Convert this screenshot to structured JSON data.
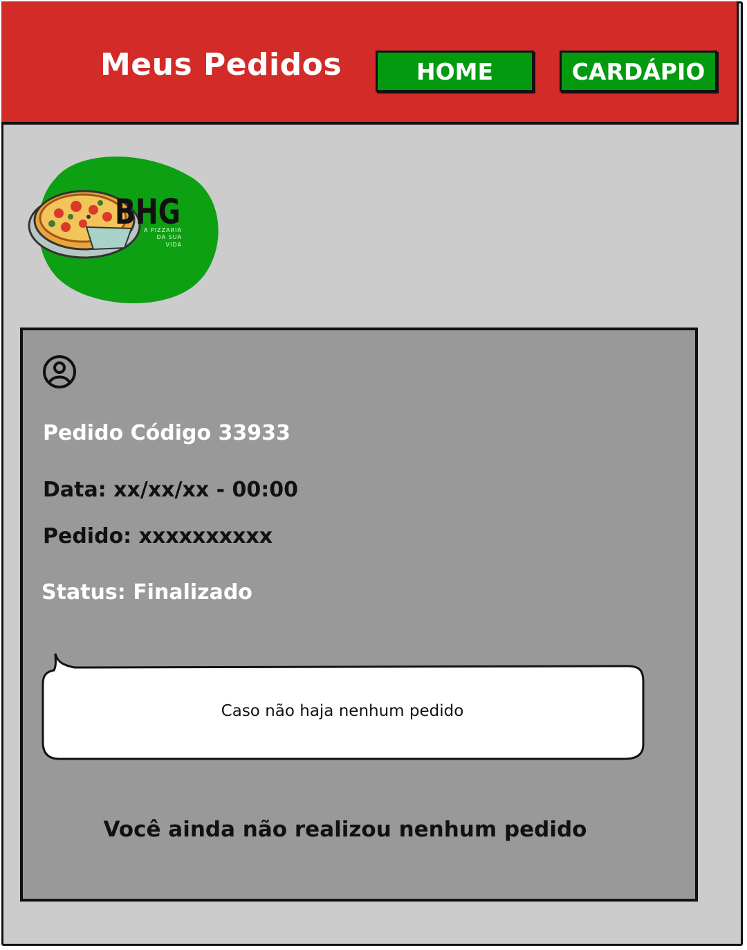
{
  "header": {
    "title": "Meus Pedidos",
    "nav": {
      "home_label": "HOME",
      "menu_label": "CARDÁPIO"
    }
  },
  "logo": {
    "brand": "BHG",
    "tagline_1": "A PIZZARIA",
    "tagline_2": "DA SUA",
    "tagline_3": "VIDA"
  },
  "order": {
    "code_label": "Pedido Código 33933",
    "date_label": "Data: xx/xx/xx  - 00:00",
    "items_label": "Pedido: xxxxxxxxxx",
    "status_label": "Status: Finalizado"
  },
  "note": {
    "bubble_text": "Caso não haja nenhum pedido",
    "empty_message": "Você ainda não realizou nenhum pedido"
  },
  "colors": {
    "header_red": "#d22b28",
    "button_green": "#039a0f",
    "frame_gray": "#cccccc",
    "card_gray": "#999999"
  }
}
